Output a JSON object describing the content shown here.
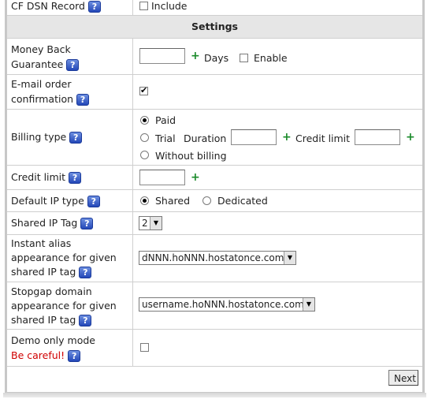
{
  "rows": {
    "dsn": {
      "label": "CF DSN Record",
      "option": "Include"
    },
    "section_title": "Settings",
    "money_back": {
      "label_line1": "Money Back",
      "label_line2": "Guarantee",
      "unit": "Days",
      "option": "Enable",
      "value": ""
    },
    "email_order": {
      "label_line1": "E-mail order",
      "label_line2": "confirmation"
    },
    "billing": {
      "label": "Billing type",
      "opt_paid": "Paid",
      "opt_trial": "Trial",
      "duration_label": "Duration",
      "credit_limit_label": "Credit limit",
      "opt_without": "Without billing"
    },
    "credit_limit": {
      "label": "Credit limit",
      "value": ""
    },
    "default_ip": {
      "label": "Default IP type",
      "opt_shared": "Shared",
      "opt_dedicated": "Dedicated"
    },
    "shared_ip_tag": {
      "label": "Shared IP Tag",
      "selected": "2"
    },
    "instant_alias": {
      "label_line1": "Instant alias",
      "label_line2": "appearance for given",
      "label_line3": "shared IP tag",
      "selected": "dNNN.hoNNN.hostatonce.com"
    },
    "stopgap": {
      "label_line1": "Stopgap domain",
      "label_line2": "appearance for given",
      "label_line3": "shared IP tag",
      "selected": "username.hoNNN.hostatonce.com"
    },
    "demo": {
      "label": "Demo only mode",
      "warning": "Be careful!"
    }
  },
  "help_glyph": "?",
  "plus_glyph": "+",
  "arrow_glyph": "▼",
  "next_label": "Next",
  "colors": {
    "accent_help": "#2448b8",
    "plus": "#1a8a2a",
    "warning": "#d00000",
    "section_bg": "#e6e6e6"
  }
}
